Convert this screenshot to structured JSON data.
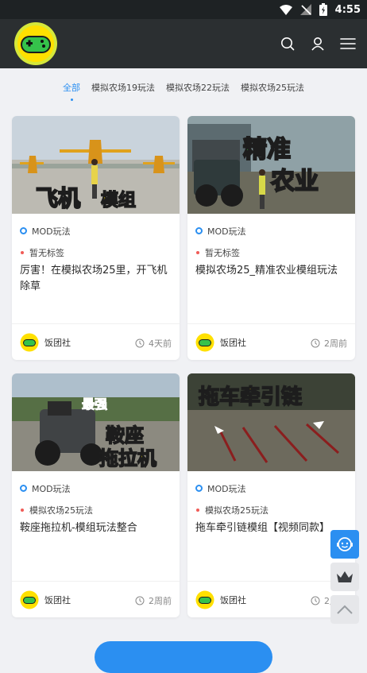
{
  "status_bar": {
    "time": "4:55"
  },
  "header": {
    "logo": "gamepad-logo",
    "icons": [
      "search-icon",
      "user-icon",
      "menu-icon"
    ]
  },
  "tabs": [
    {
      "label": "全部",
      "active": true
    },
    {
      "label": "模拟农场19玩法",
      "active": false
    },
    {
      "label": "模拟农场22玩法",
      "active": false
    },
    {
      "label": "模拟农场25玩法",
      "active": false
    }
  ],
  "cards": [
    {
      "thumb_text": "飞机 模组",
      "category": "MOD玩法",
      "tag": "暂无标签",
      "title": "厉害！在模拟农场25里，开飞机除草",
      "author": "饭团社",
      "time": "4天前"
    },
    {
      "thumb_text": "精准 农业",
      "category": "MOD玩法",
      "tag": "暂无标签",
      "title": "模拟农场25_精准农业模组玩法",
      "author": "饭团社",
      "time": "2周前"
    },
    {
      "thumb_text": "最强 鞍座 拖拉机",
      "category": "MOD玩法",
      "tag": "模拟农场25玩法",
      "title": "鞍座拖拉机-模组玩法整合",
      "author": "饭团社",
      "time": "2周前"
    },
    {
      "thumb_text": "拖车牵引链",
      "category": "MOD玩法",
      "tag": "模拟农场25玩法",
      "title": "拖车牵引链模组【视频同款】",
      "author": "饭团社",
      "time": "2周前"
    }
  ],
  "side_buttons": [
    "customer-service-icon",
    "vip-crown-icon",
    "back-to-top-icon"
  ],
  "colors": {
    "accent": "#2b8ff1",
    "tag_dot": "#f05b57",
    "header_bg": "#2b2f31"
  }
}
